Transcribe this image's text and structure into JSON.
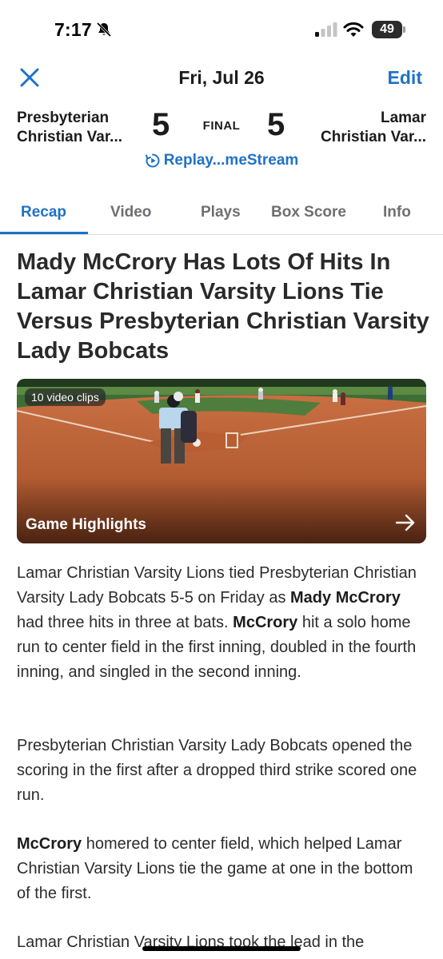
{
  "status_bar": {
    "time": "7:17",
    "battery": "49",
    "icons": [
      "bell-slash-icon",
      "cellular-signal-icon",
      "wifi-icon",
      "battery-icon"
    ]
  },
  "header": {
    "date": "Fri, Jul 26",
    "edit_label": "Edit",
    "close_icon": "close-icon"
  },
  "scoreboard": {
    "home_team_line1": "Presbyterian",
    "home_team_line2": "Christian Var...",
    "home_score": "5",
    "status": "FINAL",
    "away_score": "5",
    "away_team_line1": "Lamar",
    "away_team_line2": "Christian Var...",
    "replay_label": "Replay...meStream"
  },
  "tabs": [
    {
      "label": "Recap",
      "active": true
    },
    {
      "label": "Video",
      "active": false
    },
    {
      "label": "Plays",
      "active": false
    },
    {
      "label": "Box Score",
      "active": false
    },
    {
      "label": "Info",
      "active": false
    }
  ],
  "article": {
    "headline": "Mady McCrory Has Lots Of Hits In Lamar Christian Varsity Lions Tie Versus Presbyterian Christian Varsity Lady Bobcats",
    "video": {
      "clips_badge": "10 video clips",
      "title": "Game Highlights"
    },
    "p1": {
      "a": "Lamar Christian Varsity Lions tied Presbyterian Christian Varsity Lady Bobcats 5-5 on Friday as ",
      "b_bold": "Mady McCrory",
      "c": " had three hits in three at bats. ",
      "d_bold": "McCrory",
      "e": " hit a solo home run to center field in the first inning, doubled in the fourth inning, and singled in the second inning."
    },
    "p2": "Presbyterian Christian Varsity Lady Bobcats opened the scoring in the first after a dropped third strike scored one run.",
    "p3": {
      "a_bold": "McCrory",
      "b": " homered to center field, which helped Lamar Christian Varsity Lions tie the game at one in the bottom of the first."
    },
    "p4": "Lamar Christian Varsity Lions took the lead in the"
  }
}
